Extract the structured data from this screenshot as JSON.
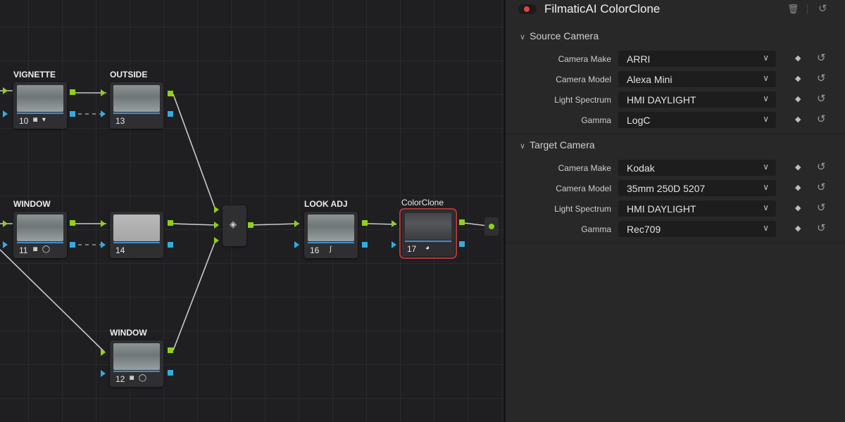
{
  "nodes": [
    {
      "id": "n10",
      "title": "VIGNETTE",
      "number": "10",
      "icons": "◙ ▾"
    },
    {
      "id": "n13",
      "title": "OUTSIDE",
      "number": "13",
      "icons": ""
    },
    {
      "id": "n11",
      "title": "WINDOW",
      "number": "11",
      "icons": "◙ ◯"
    },
    {
      "id": "n14",
      "title": "",
      "number": "14",
      "icons": ""
    },
    {
      "id": "n12",
      "title": "WINDOW",
      "number": "12",
      "icons": "◙ ◯"
    },
    {
      "id": "n16",
      "title": "LOOK ADJ",
      "number": "16",
      "icons": "∫"
    },
    {
      "id": "n17",
      "title": "ColorClone",
      "number": "17",
      "icons": "◕"
    }
  ],
  "inspector": {
    "title": "FilmaticAI ColorClone",
    "icons": {
      "power": "power-toggle",
      "trash": "trash-icon",
      "reset": "reset-icon"
    },
    "sections": [
      {
        "heading": "Source Camera",
        "rows": [
          {
            "label": "Camera Make",
            "value": "ARRI"
          },
          {
            "label": "Camera Model",
            "value": "Alexa Mini"
          },
          {
            "label": "Light Spectrum",
            "value": "HMI DAYLIGHT"
          },
          {
            "label": "Gamma",
            "value": "LogC"
          }
        ]
      },
      {
        "heading": "Target Camera",
        "rows": [
          {
            "label": "Camera Make",
            "value": "Kodak"
          },
          {
            "label": "Camera Model",
            "value": "35mm 250D 5207"
          },
          {
            "label": "Light Spectrum",
            "value": "HMI DAYLIGHT"
          },
          {
            "label": "Gamma",
            "value": "Rec709"
          }
        ]
      }
    ]
  },
  "colors": {
    "port_rgb": "#8fd019",
    "port_alpha": "#36aae0",
    "selected_outline": "#b13a36",
    "power_on": "#e4423a"
  }
}
